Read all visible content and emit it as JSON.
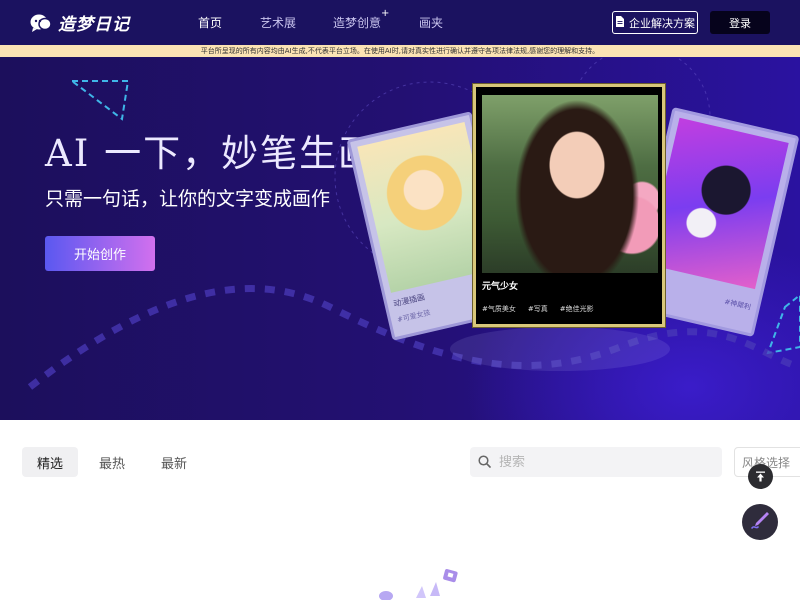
{
  "brand": {
    "name": "造梦日记"
  },
  "nav": {
    "items": [
      {
        "label": "首页",
        "active": true
      },
      {
        "label": "艺术展",
        "active": false
      },
      {
        "label": "造梦创意",
        "active": false,
        "badge": "+"
      },
      {
        "label": "画夹",
        "active": false
      }
    ],
    "enterprise_label": "企业解决方案",
    "login_label": "登录"
  },
  "notice": {
    "text": "平台所呈现的所有内容均由AI生成,不代表平台立场。在使用AI时,请对真实性进行确认并遵守各项法律法规,感谢您的理解和支持。"
  },
  "hero": {
    "title": "AI 一下，妙笔生画",
    "subtitle": "只需一句话，让你的文字变成画作",
    "cta_label": "开始创作",
    "cards": [
      {
        "position": "left",
        "label": "动漫插画",
        "tags": [
          "#可爱女孩"
        ]
      },
      {
        "position": "center",
        "title": "元气少女",
        "tags": [
          "#气质美女",
          "#写真",
          "#绝佳光影"
        ]
      },
      {
        "position": "right",
        "tags": [
          "#神犀利"
        ]
      }
    ]
  },
  "filter": {
    "tabs": [
      {
        "label": "精选",
        "active": true
      },
      {
        "label": "最热",
        "active": false
      },
      {
        "label": "最新",
        "active": false
      }
    ],
    "search_placeholder": "搜索",
    "style_select_label": "风格选择"
  },
  "colors": {
    "nav_bg": "#1b1260",
    "notice_bg": "#fbe3b4",
    "hero_bg": "#231072",
    "cta_gradient_start": "#5a58f0",
    "cta_gradient_end": "#d270ee",
    "login_bg": "#06031c"
  },
  "icons": {
    "logo": "chat-bubble-logo-icon",
    "enterprise": "document-icon",
    "search": "search-icon",
    "back_to_top": "arrow-up-icon",
    "create": "pen-icon"
  }
}
